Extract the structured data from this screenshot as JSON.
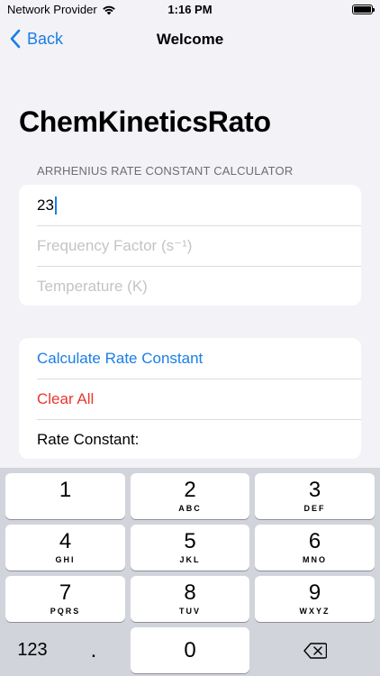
{
  "status_bar": {
    "carrier": "Network Provider",
    "time": "1:16 PM"
  },
  "nav": {
    "back_label": "Back",
    "title": "Welcome"
  },
  "app_title": "ChemKineticsRato",
  "section_header": "ARRHENIUS RATE CONSTANT CALCULATOR",
  "form": {
    "activation_energy_value": "23",
    "frequency_factor_placeholder": "Frequency Factor (s⁻¹)",
    "temperature_placeholder": "Temperature (K)"
  },
  "actions": {
    "calculate_label": "Calculate Rate Constant",
    "clear_label": "Clear All",
    "result_label": "Rate Constant:"
  },
  "keyboard": {
    "keys": [
      {
        "num": "1",
        "letters": ""
      },
      {
        "num": "2",
        "letters": "ABC"
      },
      {
        "num": "3",
        "letters": "DEF"
      },
      {
        "num": "4",
        "letters": "GHI"
      },
      {
        "num": "5",
        "letters": "JKL"
      },
      {
        "num": "6",
        "letters": "MNO"
      },
      {
        "num": "7",
        "letters": "PQRS"
      },
      {
        "num": "8",
        "letters": "TUV"
      },
      {
        "num": "9",
        "letters": "WXYZ"
      },
      {
        "num": "0",
        "letters": ""
      }
    ],
    "mode_label": "123",
    "decimal_label": "."
  },
  "colors": {
    "accent": "#1a7ee6",
    "destructive": "#e8382d",
    "background": "#f2f2f7"
  }
}
